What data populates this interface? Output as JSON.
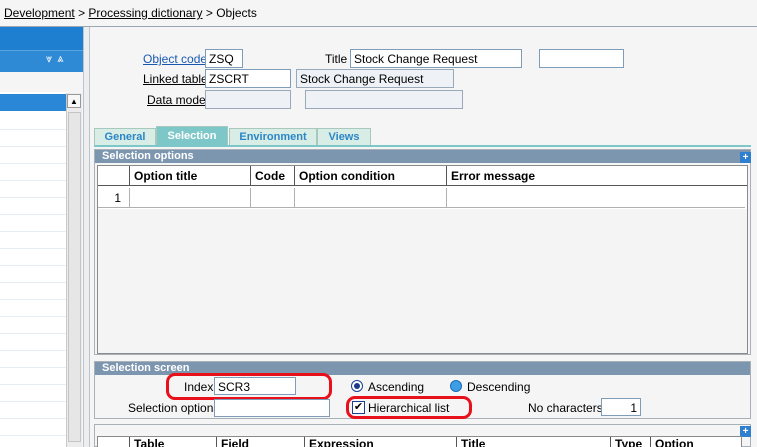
{
  "breadcrumb": {
    "items": [
      "Development",
      "Processing dictionary"
    ],
    "separator": ">",
    "current": "Objects"
  },
  "left_panel": {
    "icons": [
      "collapse-all-icon",
      "expand-all-icon"
    ]
  },
  "header": {
    "object_code": {
      "label": "Object code",
      "value": "ZSQ"
    },
    "title": {
      "label": "Title",
      "value": "Stock Change Request",
      "extra_value": ""
    },
    "linked_table": {
      "label": "Linked table",
      "value": "ZSCRT",
      "description": "Stock Change Request"
    },
    "data_model": {
      "label": "Data model",
      "value": "",
      "description": ""
    }
  },
  "tabs": [
    {
      "label": "General",
      "active": false
    },
    {
      "label": "Selection",
      "active": true
    },
    {
      "label": "Environment",
      "active": false
    },
    {
      "label": "Views",
      "active": false
    }
  ],
  "selection_options": {
    "title": "Selection options",
    "add_label": "+",
    "columns": [
      "Option title",
      "Code",
      "Option condition",
      "Error message"
    ],
    "rows": [
      {
        "num": "1",
        "cells": [
          "",
          "",
          "",
          ""
        ]
      }
    ]
  },
  "selection_screen": {
    "title": "Selection screen",
    "index": {
      "label": "Index",
      "value": "SCR3"
    },
    "order_ascending": {
      "label": "Ascending",
      "selected": true
    },
    "order_descending": {
      "label": "Descending",
      "selected": false
    },
    "selection_options": {
      "label": "Selection options",
      "value": ""
    },
    "hierarchical_list": {
      "label": "Hierarchical list",
      "checked": true
    },
    "no_characters": {
      "label": "No characters",
      "value": "1"
    }
  },
  "bottom_grid": {
    "add_label": "+",
    "columns": [
      "Table",
      "Field",
      "Expression",
      "Title",
      "Type",
      "Option"
    ]
  },
  "colors": {
    "accent": "#1e7fd0",
    "group_header": "#7d96b0",
    "tab_active": "#7ec7c8",
    "highlight_red": "#e8101a"
  }
}
